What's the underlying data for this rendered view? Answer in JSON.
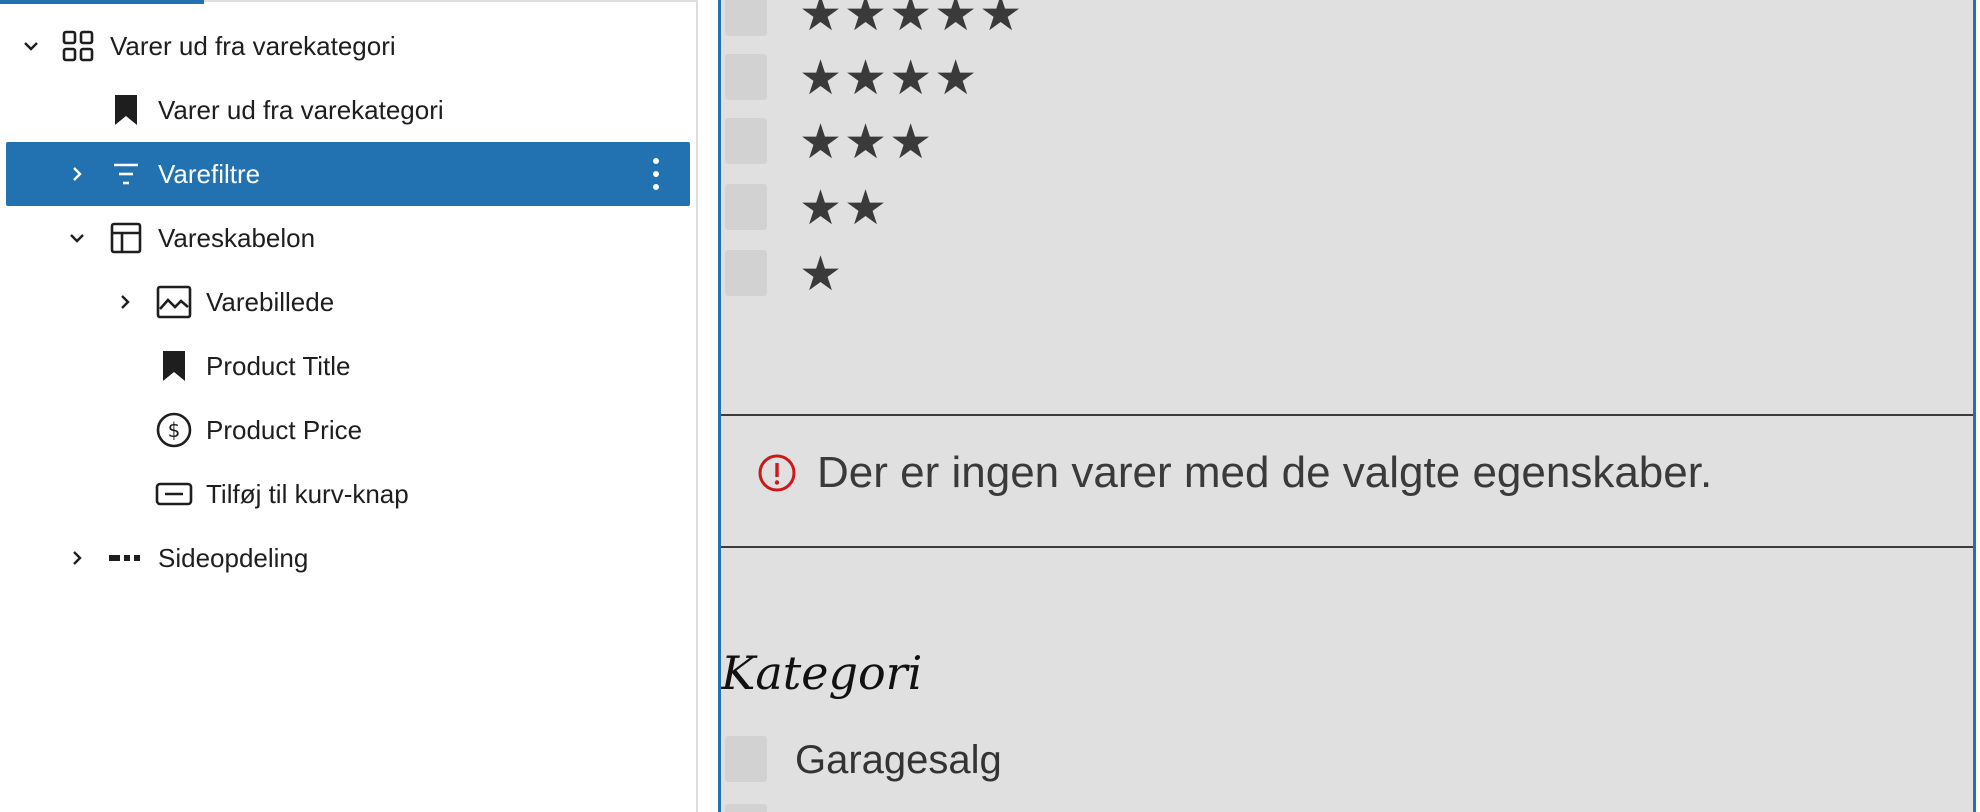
{
  "list_view": {
    "items": [
      {
        "label": "Varer ud fra varekategori",
        "icon": "grid-icon",
        "chevron": "down",
        "level": 0
      },
      {
        "label": "Varer ud fra varekategori",
        "icon": "bookmark-icon",
        "chevron": "none",
        "level": 1
      },
      {
        "label": "Varefiltre",
        "icon": "filter-icon",
        "chevron": "right",
        "level": 1,
        "selected": true
      },
      {
        "label": "Vareskabelon",
        "icon": "layout-icon",
        "chevron": "down",
        "level": 1
      },
      {
        "label": "Varebillede",
        "icon": "image-icon",
        "chevron": "right",
        "level": 2
      },
      {
        "label": "Product Title",
        "icon": "bookmark-icon",
        "chevron": "none",
        "level": 2
      },
      {
        "label": "Product Price",
        "icon": "dollar-circle-icon",
        "chevron": "none",
        "level": 2
      },
      {
        "label": "Tilføj til kurv-knap",
        "icon": "button-icon",
        "chevron": "none",
        "level": 2
      },
      {
        "label": "Sideopdeling",
        "icon": "pagination-icon",
        "chevron": "right",
        "level": 1
      }
    ],
    "options_icon": "more-vertical-icon"
  },
  "canvas": {
    "rating_filter": {
      "options": [
        {
          "stars": "★★★★★",
          "rating": 5
        },
        {
          "stars": "★★★★",
          "rating": 4
        },
        {
          "stars": "★★★",
          "rating": 3
        },
        {
          "stars": "★★",
          "rating": 2
        },
        {
          "stars": "★",
          "rating": 1
        }
      ]
    },
    "notice": {
      "icon": "warning-circle-icon",
      "text": "Der er ingen varer med de valgte egenskaber."
    },
    "category_filter": {
      "title": "Kategori",
      "options": [
        "Garagesalg"
      ]
    }
  },
  "colors": {
    "accent": "#2271b1",
    "canvas_bg": "#e0e0e0",
    "warning": "#cc1818"
  }
}
